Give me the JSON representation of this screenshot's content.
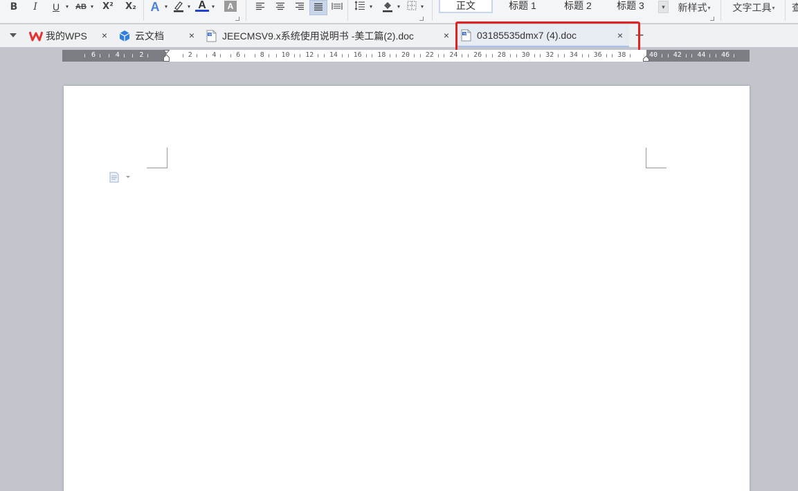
{
  "ribbon": {
    "bold": "B",
    "italic": "I",
    "underline": "U",
    "strike": "AB",
    "superscript": "X²",
    "subscript": "X₂",
    "text_effect": "A",
    "font_color": "A",
    "char_shading": "A",
    "styles": [
      "正文",
      "标题 1",
      "标题 2",
      "标题 3"
    ],
    "new_style": "新样式",
    "text_tools": "文字工具",
    "cut_off": "查"
  },
  "tabs": [
    {
      "label": "我的WPS"
    },
    {
      "label": "云文档"
    },
    {
      "label": "JEECMSV9.x系统使用说明书 -美工篇(2).doc"
    },
    {
      "label": "03185535dmx7 (4).doc"
    }
  ],
  "close_glyph": "×",
  "add_tab_glyph": "+",
  "ruler": {
    "left_numbers": [
      "6",
      "4",
      "2"
    ],
    "numbers": [
      "2",
      "4",
      "6",
      "8",
      "10",
      "12",
      "14",
      "16",
      "18",
      "20",
      "22",
      "24",
      "26",
      "28",
      "30",
      "32",
      "34",
      "36",
      "38"
    ],
    "right_numbers": [
      "40",
      "42",
      "44",
      "46"
    ]
  },
  "colors": {
    "highlight": "#e02323",
    "wps_red": "#e6322e",
    "cloud_blue": "#2f7fe0",
    "background": "#c2c5cc"
  }
}
